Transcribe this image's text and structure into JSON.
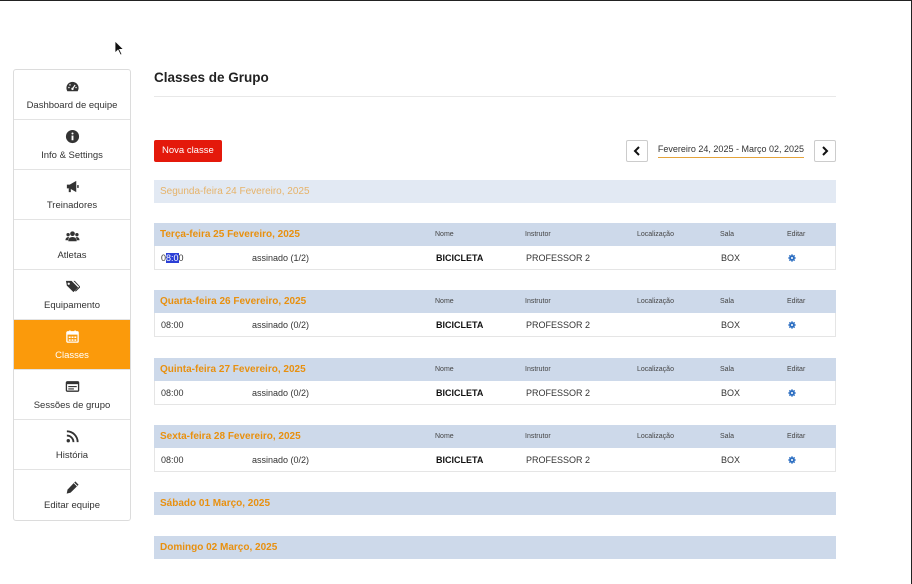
{
  "sidebar": {
    "items": [
      {
        "label": "Dashboard de equipe",
        "icon": "dashboard-icon",
        "active": false
      },
      {
        "label": "Info & Settings",
        "icon": "info-icon",
        "active": false
      },
      {
        "label": "Treinadores",
        "icon": "megaphone-icon",
        "active": false
      },
      {
        "label": "Atletas",
        "icon": "users-icon",
        "active": false
      },
      {
        "label": "Equipamento",
        "icon": "tags-icon",
        "active": false
      },
      {
        "label": "Classes",
        "icon": "calendar-icon",
        "active": true
      },
      {
        "label": "Sessões de grupo",
        "icon": "window-icon",
        "active": false
      },
      {
        "label": "História",
        "icon": "rss-icon",
        "active": false
      },
      {
        "label": "Editar equipe",
        "icon": "pencil-icon",
        "active": false
      }
    ]
  },
  "page": {
    "title": "Classes de Grupo",
    "new_class_label": "Nova classe",
    "date_range": "Fevereiro 24, 2025 - Março 02, 2025"
  },
  "columns": {
    "name": "Nome",
    "instructor": "Instrutor",
    "location": "Localização",
    "room": "Sala",
    "edit": "Editar"
  },
  "days": [
    {
      "label": "Segunda-feira 24 Fevereiro, 2025",
      "classes": []
    },
    {
      "label": "Terça-feira 25 Fevereiro, 2025",
      "classes": [
        {
          "time_a": "0",
          "time_sel": "8:0",
          "time_b": "0",
          "status": "assinado (1/2)",
          "name": "BICICLETA",
          "instructor": "PROFESSOR 2",
          "location": "",
          "room": "BOX"
        }
      ]
    },
    {
      "label": "Quarta-feira 26 Fevereiro, 2025",
      "classes": [
        {
          "time": "08:00",
          "status": "assinado (0/2)",
          "name": "BICICLETA",
          "instructor": "PROFESSOR 2",
          "location": "",
          "room": "BOX"
        }
      ]
    },
    {
      "label": "Quinta-feira 27 Fevereiro, 2025",
      "classes": [
        {
          "time": "08:00",
          "status": "assinado (0/2)",
          "name": "BICICLETA",
          "instructor": "PROFESSOR 2",
          "location": "",
          "room": "BOX"
        }
      ]
    },
    {
      "label": "Sexta-feira 28 Fevereiro, 2025",
      "classes": [
        {
          "time": "08:00",
          "status": "assinado (0/2)",
          "name": "BICICLETA",
          "instructor": "PROFESSOR 2",
          "location": "",
          "room": "BOX"
        }
      ]
    },
    {
      "label": "Sábado 01 Março, 2025",
      "classes": []
    },
    {
      "label": "Domingo 02 Março, 2025",
      "classes": []
    }
  ],
  "colors": {
    "accent": "#fb9a0b",
    "new_button": "#e4190b",
    "day_header": "#cdd9ea",
    "day_label": "#e8900f",
    "gear": "#2d6fc2"
  }
}
